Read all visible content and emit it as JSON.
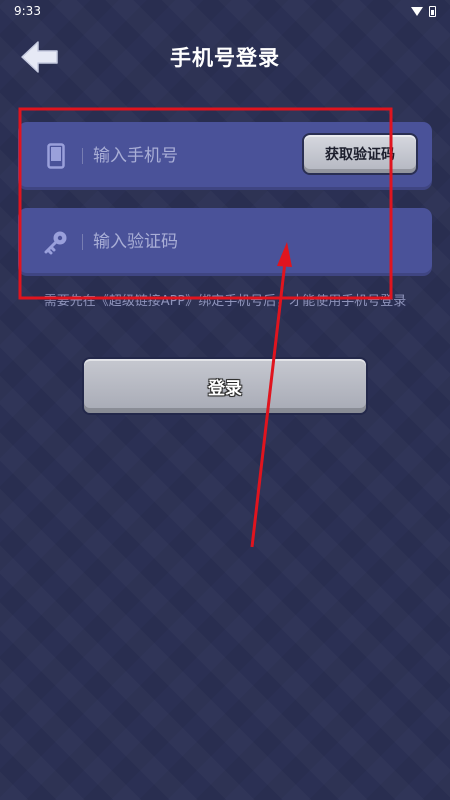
{
  "status_bar": {
    "time": "9:33"
  },
  "header": {
    "title": "手机号登录"
  },
  "phone_field": {
    "placeholder": "输入手机号",
    "get_code_label": "获取验证码"
  },
  "code_field": {
    "placeholder": "输入验证码"
  },
  "hint": "需要先在《超级链接APP》绑定手机号后，才能使用手机号登录",
  "login_button": {
    "label": "登录"
  },
  "colors": {
    "background": "#2a2f52",
    "field": "#4a5299",
    "button": "#b8bac4",
    "annotation": "#e0141e"
  }
}
